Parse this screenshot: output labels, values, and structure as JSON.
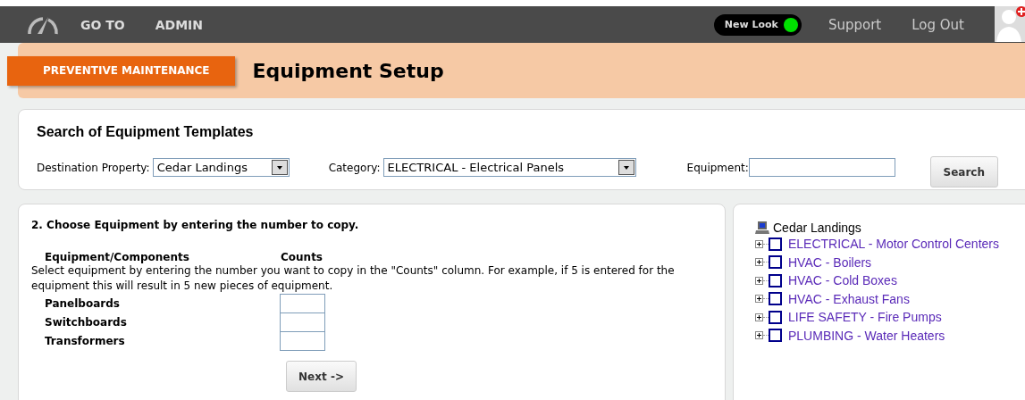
{
  "topbar": {
    "menu": [
      "GO TO",
      "ADMIN"
    ],
    "new_look": {
      "label": "New Look",
      "on": true
    },
    "links": [
      "Support",
      "Log Out"
    ]
  },
  "header": {
    "module": "PREVENTIVE MAINTENANCE",
    "title": "Equipment Setup"
  },
  "search": {
    "title": "Search of Equipment Templates",
    "property_label": "Destination Property:",
    "property_value": "Cedar Landings",
    "category_label": "Category:",
    "category_value": "ELECTRICAL - Electrical Panels",
    "equipment_label": "Equipment:",
    "button": "Search"
  },
  "choose": {
    "title": "2. Choose Equipment by entering the number to copy.",
    "columns": [
      "Equipment/Components",
      "Counts"
    ],
    "instructions": "Select equipment by entering the number you want to copy in the \"Counts\" column.   For example, if 5 is entered for the equipment this will result in 5 new pieces of equipment.",
    "rows": [
      {
        "name": "Panelboards"
      },
      {
        "name": "Switchboards"
      },
      {
        "name": "Transformers"
      }
    ],
    "button": "Next ->"
  },
  "tree": {
    "root": "Cedar Landings",
    "items": [
      {
        "label": "ELECTRICAL - Motor Control Centers",
        "expanded": false,
        "checked": false
      },
      {
        "label": "HVAC - Boilers",
        "expanded": false,
        "checked": false
      },
      {
        "label": "HVAC - Cold Boxes",
        "expanded": false,
        "checked": false
      },
      {
        "label": "HVAC - Exhaust Fans",
        "expanded": false,
        "checked": false
      },
      {
        "label": "LIFE SAFETY - Fire Pumps",
        "expanded": false,
        "checked": false
      },
      {
        "label": "PLUMBING - Water Heaters",
        "expanded": false,
        "checked": false
      }
    ]
  }
}
